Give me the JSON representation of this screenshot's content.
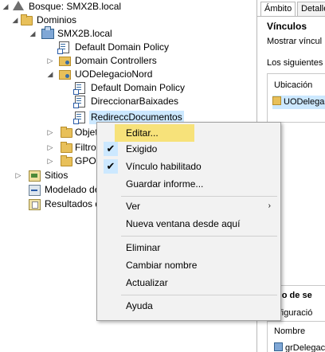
{
  "tree": {
    "forest": "Bosque: SMX2B.local",
    "domains": "Dominios",
    "domain": "SMX2B.local",
    "default_domain_policy": "Default Domain Policy",
    "domain_controllers": "Domain Controllers",
    "ou": "UODelegacioNord",
    "ou_default_policy": "Default Domain Policy",
    "ou_gpo1": "DireccionarBaixades",
    "ou_gpo2": "RedireccDocumentos",
    "objects": "Objet",
    "filters": "Filtro",
    "gpo": "GPO",
    "sites": "Sitios",
    "modeling": "Modelado de",
    "results": "Resultados d"
  },
  "right": {
    "tab_scope": "Ámbito",
    "tab_detail": "Detalle",
    "title": "Vínculos",
    "show_links": "Mostrar víncul",
    "following": "Los siguientes s",
    "col_location": "Ubicación",
    "selected_location": "UODelega",
    "filter_title": "trado de se",
    "filter_text": "configuració",
    "col_name": "Nombre",
    "name_value": "grDelegac"
  },
  "context_menu": {
    "edit": "Editar...",
    "enforced": "Exigido",
    "link_enabled": "Vínculo habilitado",
    "save_report": "Guardar informe...",
    "view": "Ver",
    "new_window": "Nueva ventana desde aquí",
    "delete": "Eliminar",
    "rename": "Cambiar nombre",
    "refresh": "Actualizar",
    "help": "Ayuda",
    "check_glyph": "✔",
    "submenu_glyph": "›"
  },
  "colors": {
    "menu_highlight": "#f7e27a",
    "selection": "#cce8ff",
    "menu_bg": "#f2f2f2"
  }
}
